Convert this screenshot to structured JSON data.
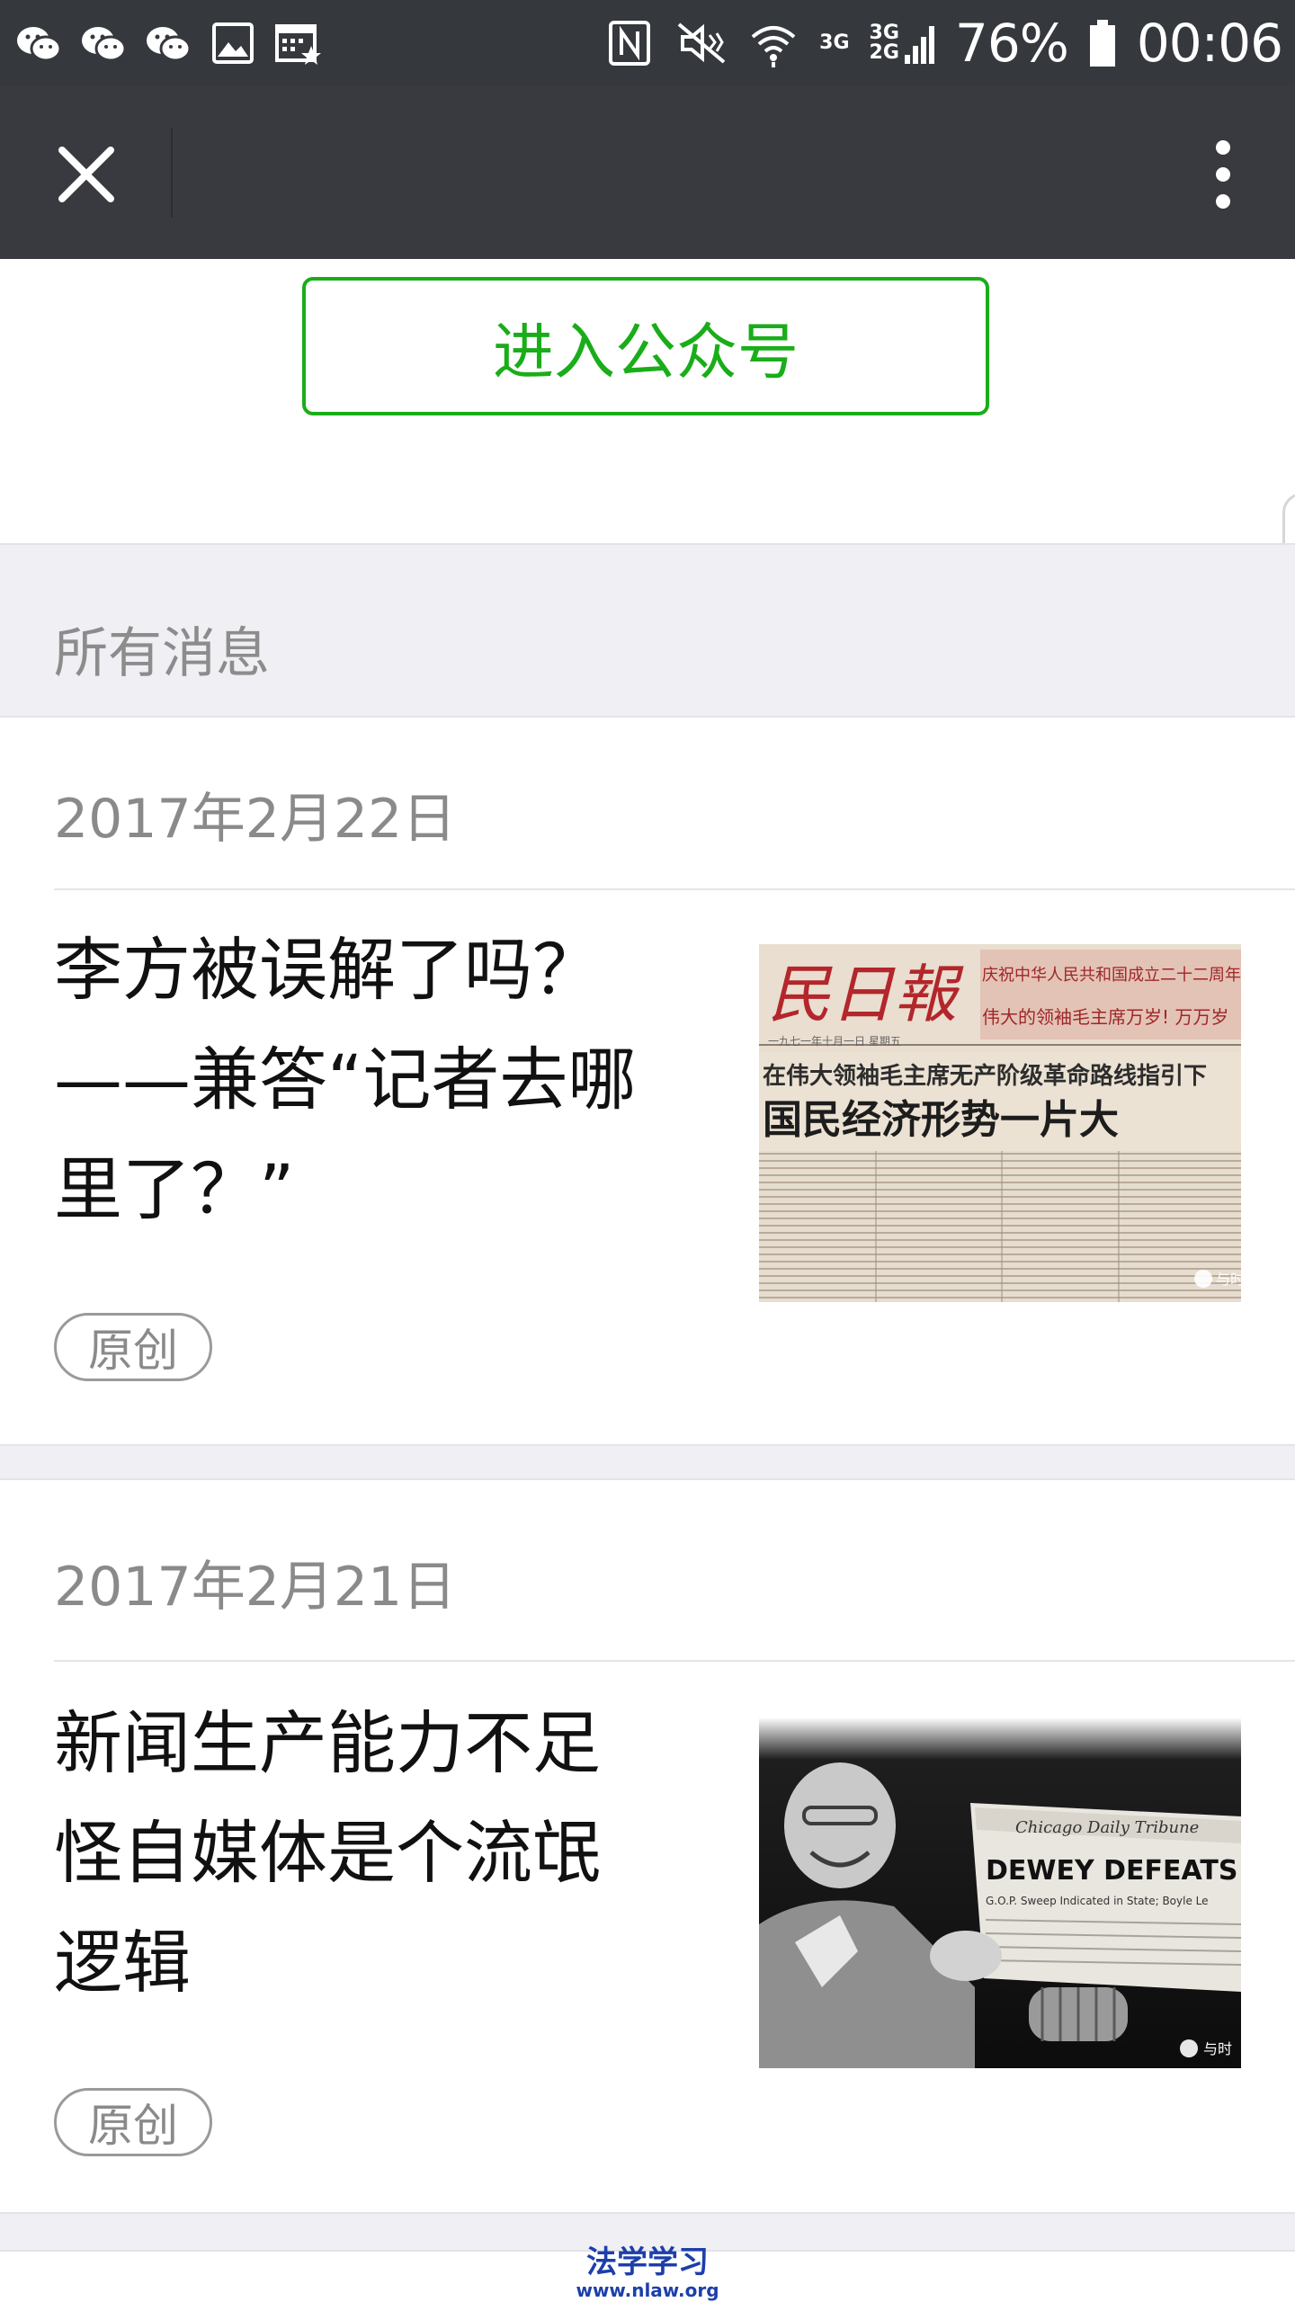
{
  "status_bar": {
    "battery": "76%",
    "time": "00:06",
    "net1": "3G",
    "net2a": "3G",
    "net2b": "2G",
    "icons": [
      "wechat-icon",
      "wechat-icon",
      "wechat-icon",
      "image-icon",
      "calendar-star-icon",
      "nfc-icon",
      "mute-icon",
      "wifi-icon",
      "signal-icon",
      "battery-icon"
    ]
  },
  "nav": {
    "close_icon": "close-icon",
    "more_icon": "more-vertical-icon"
  },
  "enter_button": "进入公众号",
  "section_title": "所有消息",
  "messages": [
    {
      "date": "2017年2月22日",
      "title": "李方被误解了吗？——兼答“记者去哪里了？”",
      "tag": "原创",
      "thumb_text": {
        "masthead": "民日報",
        "headline": "国民经济形势一片大",
        "banner1": "庆祝中华人民共和国成立二十二周年",
        "banner2": "伟大的领袖毛主席万岁! 万万岁",
        "subline": "在伟大领袖毛主席无产阶级革命路线指引下",
        "date_line": "一九七一年十月一日  星期五"
      }
    },
    {
      "date": "2017年2月21日",
      "title": "新闻生产能力不足怪自媒体是个流氓逻辑",
      "tag": "原创",
      "thumb_text": {
        "masthead": "Chicago Daily Tribune",
        "headline": "DEWEY DEFEATS TRU",
        "subline": "G.O.P. Sweep Indicated in State; Boyle Le"
      }
    }
  ],
  "watermark": {
    "line1": "法学学习",
    "line2": "www.nlaw.org"
  },
  "thumb_corner": "与时",
  "colors": {
    "accent_green": "#1aad19",
    "status_bar": "#35383d",
    "nav_bar": "#393a3f",
    "section_bg": "#efeff4",
    "watermark": "#1d3faa"
  }
}
